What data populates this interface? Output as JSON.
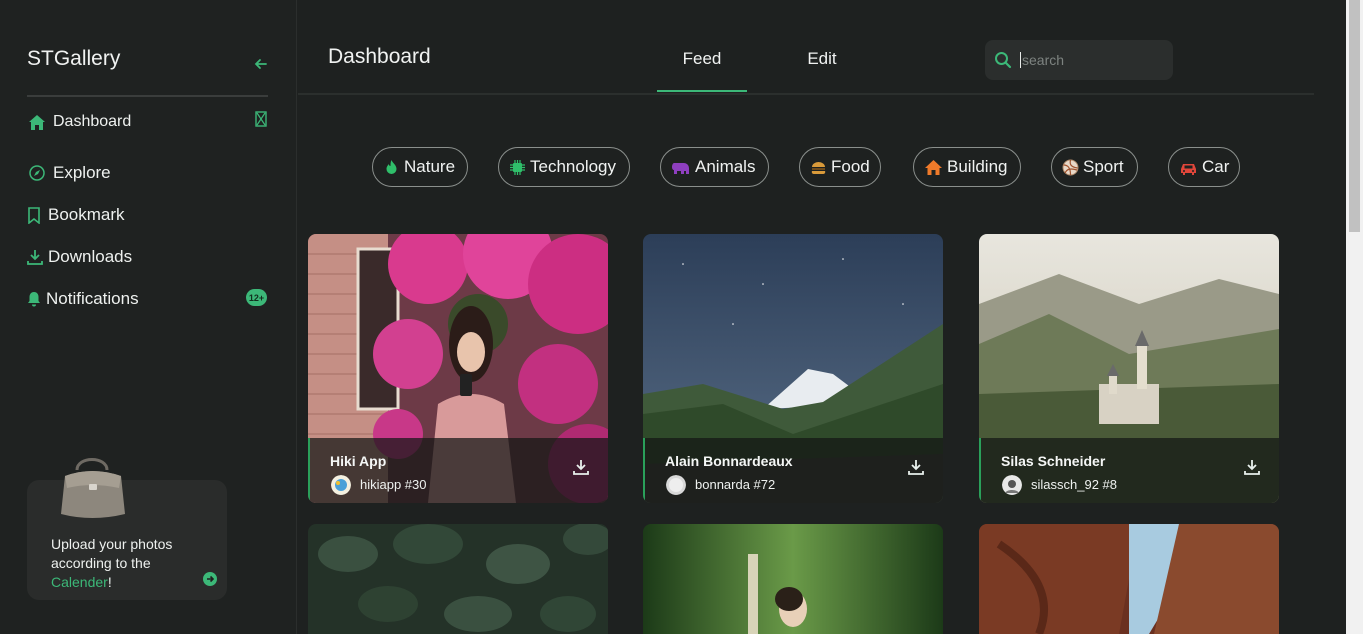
{
  "sidebar": {
    "brand": "STGallery",
    "items": [
      {
        "label": "Dashboard",
        "icon": "home-icon"
      },
      {
        "label": "Explore",
        "icon": "compass-icon"
      },
      {
        "label": "Bookmark",
        "icon": "bookmark-icon"
      },
      {
        "label": "Downloads",
        "icon": "download-icon"
      },
      {
        "label": "Notifications",
        "icon": "bell-icon"
      }
    ],
    "notifications_badge": "12+",
    "upload_card": {
      "text_before": "Upload your photos according to the ",
      "link": "Calender",
      "text_after": "!"
    }
  },
  "header": {
    "title": "Dashboard",
    "tabs": [
      {
        "label": "Feed",
        "active": true
      },
      {
        "label": "Edit",
        "active": false
      }
    ],
    "search_placeholder": "search"
  },
  "categories": [
    {
      "label": "Nature",
      "icon": "flame-icon",
      "color": "#2fbf6a"
    },
    {
      "label": "Technology",
      "icon": "chip-icon",
      "color": "#2fbf6a"
    },
    {
      "label": "Animals",
      "icon": "elephant-icon",
      "color": "#8e3fbf"
    },
    {
      "label": "Food",
      "icon": "burger-icon",
      "color": "#d99a3a"
    },
    {
      "label": "Building",
      "icon": "house-icon",
      "color": "#ef7a2a"
    },
    {
      "label": "Sport",
      "icon": "volleyball-icon",
      "color": "#d0b090"
    },
    {
      "label": "Car",
      "icon": "car-icon",
      "color": "#e0463a"
    }
  ],
  "cards": [
    {
      "author": "Hiki App",
      "handle": "hikiapp #30"
    },
    {
      "author": "Alain Bonnardeaux",
      "handle": "bonnarda #72"
    },
    {
      "author": "Silas Schneider",
      "handle": "silassch_92 #8"
    }
  ],
  "colors": {
    "accent": "#3cb878",
    "background": "#1e2120"
  }
}
